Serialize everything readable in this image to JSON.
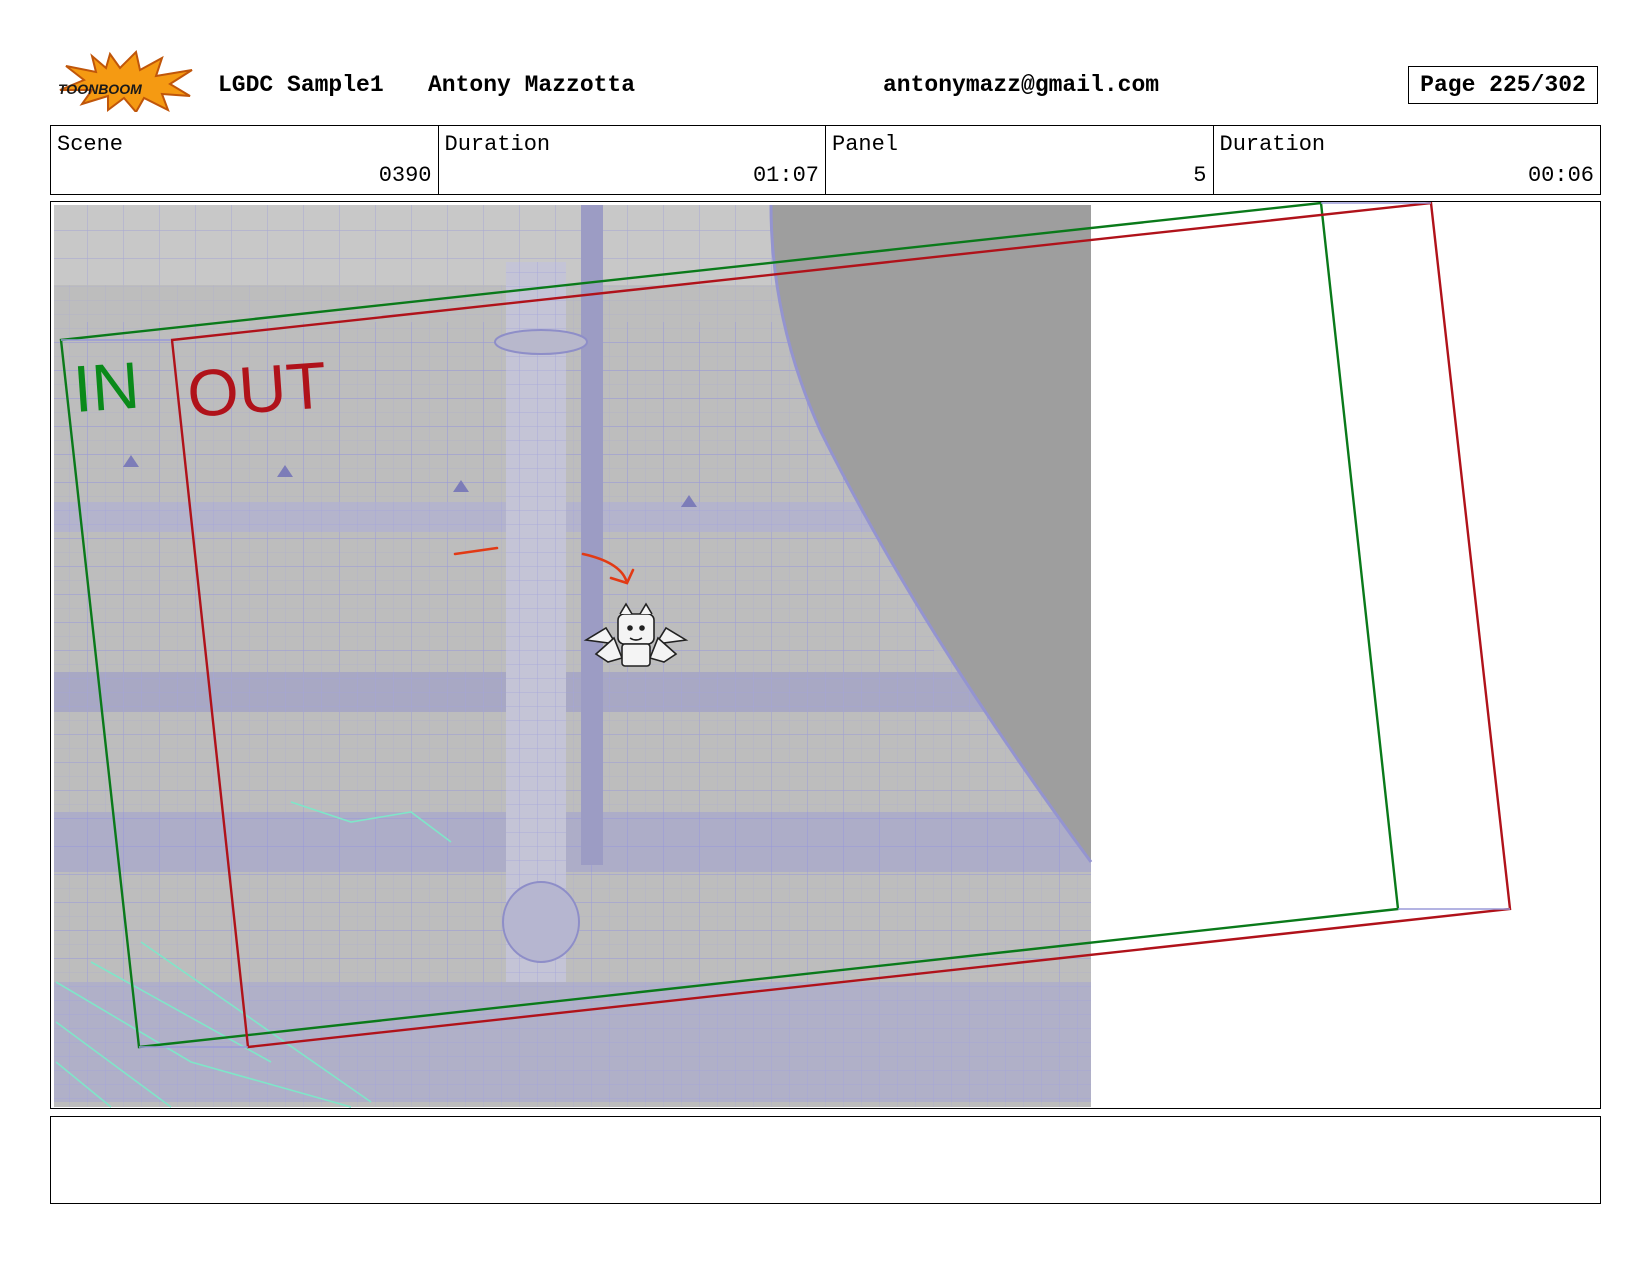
{
  "header": {
    "logo_text": "TOONBOOM",
    "project": "LGDC Sample1",
    "author": "Antony Mazzotta",
    "email": "antonymazz@gmail.com",
    "page_label": "Page 225/302"
  },
  "info": {
    "scene_label": "Scene",
    "scene_value": "0390",
    "scene_duration_label": "Duration",
    "scene_duration_value": "01:07",
    "panel_label": "Panel",
    "panel_value": "5",
    "panel_duration_label": "Duration",
    "panel_duration_value": "00:06"
  },
  "panel": {
    "in_label": "IN",
    "out_label": "OUT",
    "in_color": "#0a8a1a",
    "out_color": "#b0121a"
  },
  "notes": {
    "text": ""
  }
}
